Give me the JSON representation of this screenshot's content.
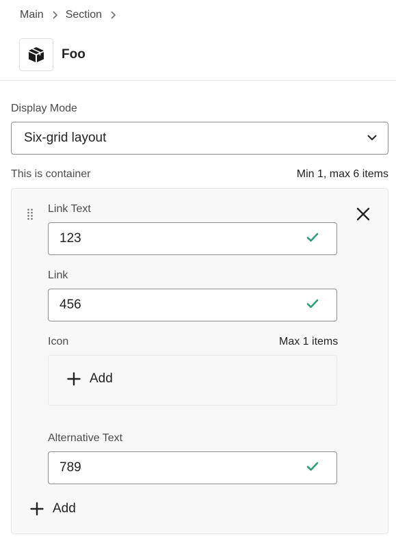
{
  "breadcrumb": {
    "items": [
      "Main",
      "Section"
    ]
  },
  "header": {
    "title": "Foo",
    "icon": "package-icon"
  },
  "display_mode": {
    "label": "Display Mode",
    "value": "Six-grid layout"
  },
  "container": {
    "label": "This is container",
    "hint": "Min 1, max 6 items",
    "item": {
      "link_text": {
        "label": "Link Text",
        "value": "123"
      },
      "link": {
        "label": "Link",
        "value": "456"
      },
      "icon": {
        "label": "Icon",
        "hint": "Max 1 items",
        "add_label": "Add"
      },
      "alt_text": {
        "label": "Alternative Text",
        "value": "789"
      }
    },
    "add_label": "Add"
  },
  "colors": {
    "check": "#2d9d78",
    "border": "#8e8e8e",
    "container_bg": "#f8f8f8"
  }
}
